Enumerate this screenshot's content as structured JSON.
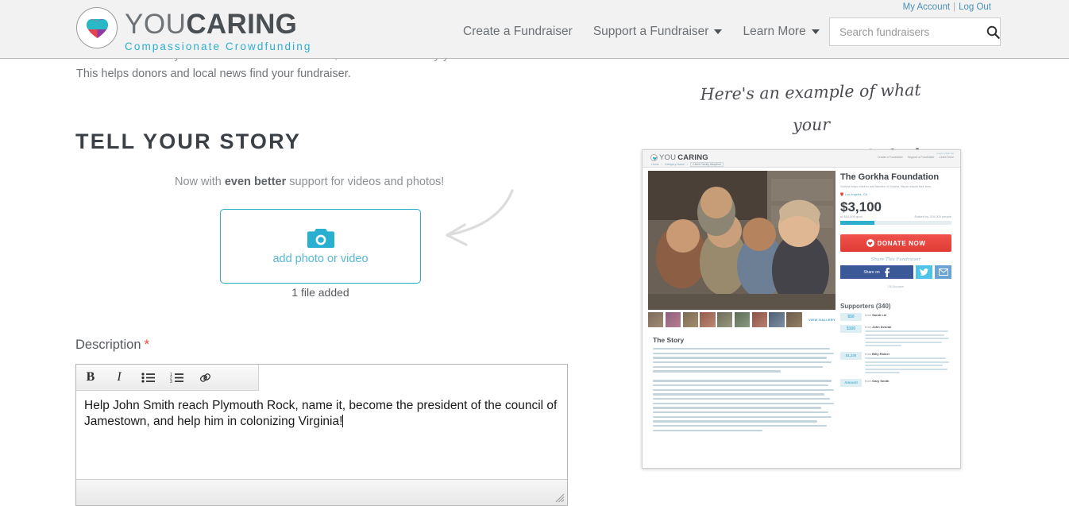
{
  "header": {
    "account_link": "My Account",
    "logout_link": "Log Out",
    "logo_you": "YOU",
    "logo_caring": "CARING",
    "logo_tagline": "Compassionate Crowdfunding",
    "nav": [
      {
        "label": "Create a Fundraiser",
        "caret": false
      },
      {
        "label": "Support a Fundraiser",
        "caret": true
      },
      {
        "label": "Learn More",
        "caret": true
      }
    ],
    "search_placeholder": "Search fundraisers",
    "search_value": "",
    "search_icon": "search-icon"
  },
  "page": {
    "ghost_line": "...ease enter the city where the fundraiser is based, and not necessarily your location.",
    "helper_text": "This helps donors and local news find your fundraiser.",
    "section_title": "TELL YOUR STORY",
    "subtitle_pre": "Now with ",
    "subtitle_bold": "even better",
    "subtitle_post": " support for videos and photos!"
  },
  "upload": {
    "icon": "camera-icon",
    "label": "add photo or video",
    "status": "1 file added",
    "border_color": "#29abc9"
  },
  "description": {
    "label": "Description",
    "required_mark": "*",
    "toolbar": [
      {
        "name": "bold-button",
        "glyph": "B"
      },
      {
        "name": "italic-button",
        "glyph": "I"
      },
      {
        "name": "unordered-list-button",
        "glyph": ""
      },
      {
        "name": "ordered-list-button",
        "glyph": ""
      },
      {
        "name": "link-button",
        "glyph": ""
      }
    ],
    "value": "Help John Smith reach Plymouth Rock, name it, become the president of the council of Jamestown, and help him in colonizing Virginia!"
  },
  "annotation": {
    "line1": "Here's an example of what your",
    "line2": "fundraiser page might look like"
  },
  "preview": {
    "logo_you": "YOU",
    "logo_caring": "CARING",
    "topright": "Log In | Sign Up",
    "nav": [
      "Create a Fundraiser",
      "Support a Fundraiser",
      "Learn More"
    ],
    "breadcrumbs": [
      "Home",
      "Category Name",
      "Client Family Adoption"
    ],
    "view_gallery": "VIEW GALLERY",
    "story_title": "The Story",
    "fundraiser_title": "The Gorkha Foundation",
    "fundraiser_sub": "Gorkha helps children and families of Gorkha, Nepal rebuild their lives.",
    "location": "Los Angeles, CA",
    "amount_raised": "$3,100",
    "goal_text": "of $10,000 goal",
    "raised_by": "Raised by 320,000 people",
    "progress_percent": 31,
    "donate_label": "DONATE NOW",
    "share_title": "Share This Fundraiser",
    "share_on": "Share on",
    "share_count": "150.3k",
    "share_count_sub": "shares",
    "supporters_title": "Supporters (340)",
    "supporters": [
      {
        "amount": "$50",
        "from_prefix": "from ",
        "name": "Sarah Lin",
        "lines": 0
      },
      {
        "amount": "$100",
        "from_prefix": "from ",
        "name": "John Dvorak",
        "lines": 5
      },
      {
        "amount": "$1,100",
        "from_prefix": "from ",
        "name": "Billy Rainer",
        "lines": 5
      },
      {
        "amount": "Amount",
        "from_prefix": "from ",
        "name": "Gary Smith",
        "lines": 0
      }
    ]
  },
  "colors": {
    "brand_cyan": "#2eaecd",
    "donate_red": "#e03b35",
    "facebook_blue": "#3b5998",
    "link_blue": "#4a90b8"
  }
}
